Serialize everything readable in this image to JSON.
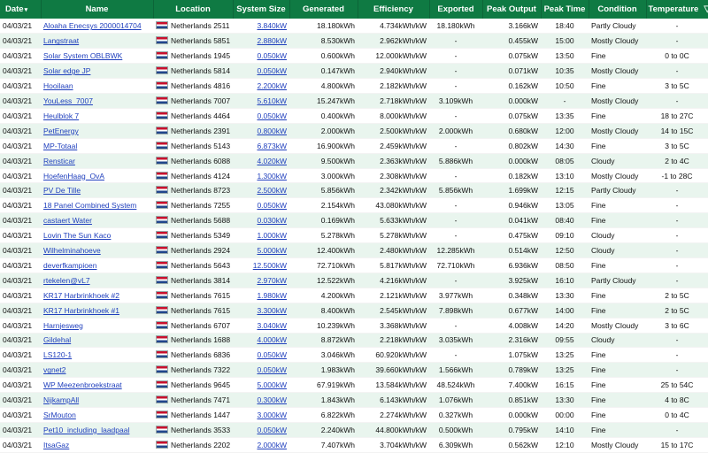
{
  "headers": {
    "date": "Date",
    "sort_indicator": "▾",
    "name": "Name",
    "location": "Location",
    "system_size": "System Size",
    "generated": "Generated",
    "efficiency": "Efficiency",
    "exported": "Exported",
    "peak_output": "Peak Output",
    "peak_time": "Peak Time",
    "condition": "Condition",
    "temperature": "Temperature",
    "filter_icon": "▽"
  },
  "rows": [
    {
      "date": "04/03/21",
      "name": "Aloaha Enecsys 2000014704",
      "location": "Netherlands 2511",
      "size": "3.840kW",
      "generated": "18.180kWh",
      "efficiency": "4.734kWh/kW",
      "exported": "18.180kWh",
      "peak": "3.166kW",
      "time": "18:40",
      "condition": "Partly Cloudy",
      "temp": "-"
    },
    {
      "date": "04/03/21",
      "name": "Langstraat",
      "location": "Netherlands 5851",
      "size": "2.880kW",
      "generated": "8.530kWh",
      "efficiency": "2.962kWh/kW",
      "exported": "-",
      "peak": "0.455kW",
      "time": "15:00",
      "condition": "Mostly Cloudy",
      "temp": "-"
    },
    {
      "date": "04/03/21",
      "name": "Solar System OBLBWK",
      "location": "Netherlands 1945",
      "size": "0.050kW",
      "generated": "0.600kWh",
      "efficiency": "12.000kWh/kW",
      "exported": "-",
      "peak": "0.075kW",
      "time": "13:50",
      "condition": "Fine",
      "temp": "0 to 0C"
    },
    {
      "date": "04/03/21",
      "name": "Solar edge JP",
      "location": "Netherlands 5814",
      "size": "0.050kW",
      "generated": "0.147kWh",
      "efficiency": "2.940kWh/kW",
      "exported": "-",
      "peak": "0.071kW",
      "time": "10:35",
      "condition": "Mostly Cloudy",
      "temp": "-"
    },
    {
      "date": "04/03/21",
      "name": "Hooilaan",
      "location": "Netherlands 4816",
      "size": "2.200kW",
      "generated": "4.800kWh",
      "efficiency": "2.182kWh/kW",
      "exported": "-",
      "peak": "0.162kW",
      "time": "10:50",
      "condition": "Fine",
      "temp": "3 to 5C"
    },
    {
      "date": "04/03/21",
      "name": "YouLess_7007",
      "location": "Netherlands 7007",
      "size": "5.610kW",
      "generated": "15.247kWh",
      "efficiency": "2.718kWh/kW",
      "exported": "3.109kWh",
      "peak": "0.000kW",
      "time": "-",
      "condition": "Mostly Cloudy",
      "temp": "-"
    },
    {
      "date": "04/03/21",
      "name": "Heulblok 7",
      "location": "Netherlands 4464",
      "size": "0.050kW",
      "generated": "0.400kWh",
      "efficiency": "8.000kWh/kW",
      "exported": "-",
      "peak": "0.075kW",
      "time": "13:35",
      "condition": "Fine",
      "temp": "18 to 27C"
    },
    {
      "date": "04/03/21",
      "name": "PetEnergy",
      "location": "Netherlands 2391",
      "size": "0.800kW",
      "generated": "2.000kWh",
      "efficiency": "2.500kWh/kW",
      "exported": "2.000kWh",
      "peak": "0.680kW",
      "time": "12:00",
      "condition": "Mostly Cloudy",
      "temp": "14 to 15C"
    },
    {
      "date": "04/03/21",
      "name": "MP-Totaal",
      "location": "Netherlands 5143",
      "size": "6.873kW",
      "generated": "16.900kWh",
      "efficiency": "2.459kWh/kW",
      "exported": "-",
      "peak": "0.802kW",
      "time": "14:30",
      "condition": "Fine",
      "temp": "3 to 5C"
    },
    {
      "date": "04/03/21",
      "name": "Rensticar",
      "location": "Netherlands 6088",
      "size": "4.020kW",
      "generated": "9.500kWh",
      "efficiency": "2.363kWh/kW",
      "exported": "5.886kWh",
      "peak": "0.000kW",
      "time": "08:05",
      "condition": "Cloudy",
      "temp": "2 to 4C"
    },
    {
      "date": "04/03/21",
      "name": "HoefenHaag_OvA",
      "location": "Netherlands 4124",
      "size": "1.300kW",
      "generated": "3.000kWh",
      "efficiency": "2.308kWh/kW",
      "exported": "-",
      "peak": "0.182kW",
      "time": "13:10",
      "condition": "Mostly Cloudy",
      "temp": "-1 to 28C"
    },
    {
      "date": "04/03/21",
      "name": "PV De Tille",
      "location": "Netherlands 8723",
      "size": "2.500kW",
      "generated": "5.856kWh",
      "efficiency": "2.342kWh/kW",
      "exported": "5.856kWh",
      "peak": "1.699kW",
      "time": "12:15",
      "condition": "Partly Cloudy",
      "temp": "-"
    },
    {
      "date": "04/03/21",
      "name": "18 Panel Combined System",
      "location": "Netherlands 7255",
      "size": "0.050kW",
      "generated": "2.154kWh",
      "efficiency": "43.080kWh/kW",
      "exported": "-",
      "peak": "0.946kW",
      "time": "13:05",
      "condition": "Fine",
      "temp": "-"
    },
    {
      "date": "04/03/21",
      "name": "castaert Water",
      "location": "Netherlands 5688",
      "size": "0.030kW",
      "generated": "0.169kWh",
      "efficiency": "5.633kWh/kW",
      "exported": "-",
      "peak": "0.041kW",
      "time": "08:40",
      "condition": "Fine",
      "temp": "-"
    },
    {
      "date": "04/03/21",
      "name": "Lovin The Sun Kaco",
      "location": "Netherlands 5349",
      "size": "1.000kW",
      "generated": "5.278kWh",
      "efficiency": "5.278kWh/kW",
      "exported": "-",
      "peak": "0.475kW",
      "time": "09:10",
      "condition": "Cloudy",
      "temp": "-"
    },
    {
      "date": "04/03/21",
      "name": "Wilhelminahoeve",
      "location": "Netherlands 2924",
      "size": "5.000kW",
      "generated": "12.400kWh",
      "efficiency": "2.480kWh/kW",
      "exported": "12.285kWh",
      "peak": "0.514kW",
      "time": "12:50",
      "condition": "Cloudy",
      "temp": "-"
    },
    {
      "date": "04/03/21",
      "name": "deverfkampioen",
      "location": "Netherlands 5643",
      "size": "12.500kW",
      "generated": "72.710kWh",
      "efficiency": "5.817kWh/kW",
      "exported": "72.710kWh",
      "peak": "6.936kW",
      "time": "08:50",
      "condition": "Fine",
      "temp": "-"
    },
    {
      "date": "04/03/21",
      "name": "rtekelen@vL7",
      "location": "Netherlands 3814",
      "size": "2.970kW",
      "generated": "12.522kWh",
      "efficiency": "4.216kWh/kW",
      "exported": "-",
      "peak": "3.925kW",
      "time": "16:10",
      "condition": "Partly Cloudy",
      "temp": "-"
    },
    {
      "date": "04/03/21",
      "name": "KR17 Harbrinkhoek #2",
      "location": "Netherlands 7615",
      "size": "1.980kW",
      "generated": "4.200kWh",
      "efficiency": "2.121kWh/kW",
      "exported": "3.977kWh",
      "peak": "0.348kW",
      "time": "13:30",
      "condition": "Fine",
      "temp": "2 to 5C"
    },
    {
      "date": "04/03/21",
      "name": "KR17 Harbrinkhoek #1",
      "location": "Netherlands 7615",
      "size": "3.300kW",
      "generated": "8.400kWh",
      "efficiency": "2.545kWh/kW",
      "exported": "7.898kWh",
      "peak": "0.677kW",
      "time": "14:00",
      "condition": "Fine",
      "temp": "2 to 5C"
    },
    {
      "date": "04/03/21",
      "name": "Harnjesweg",
      "location": "Netherlands 6707",
      "size": "3.040kW",
      "generated": "10.239kWh",
      "efficiency": "3.368kWh/kW",
      "exported": "-",
      "peak": "4.008kW",
      "time": "14:20",
      "condition": "Mostly Cloudy",
      "temp": "3 to 6C"
    },
    {
      "date": "04/03/21",
      "name": "Gildehal",
      "location": "Netherlands 1688",
      "size": "4.000kW",
      "generated": "8.872kWh",
      "efficiency": "2.218kWh/kW",
      "exported": "3.035kWh",
      "peak": "2.316kW",
      "time": "09:55",
      "condition": "Cloudy",
      "temp": "-"
    },
    {
      "date": "04/03/21",
      "name": "LS120-1",
      "location": "Netherlands 6836",
      "size": "0.050kW",
      "generated": "3.046kWh",
      "efficiency": "60.920kWh/kW",
      "exported": "-",
      "peak": "1.075kW",
      "time": "13:25",
      "condition": "Fine",
      "temp": "-"
    },
    {
      "date": "04/03/21",
      "name": "vgnet2",
      "location": "Netherlands 7322",
      "size": "0.050kW",
      "generated": "1.983kWh",
      "efficiency": "39.660kWh/kW",
      "exported": "1.566kWh",
      "peak": "0.789kW",
      "time": "13:25",
      "condition": "Fine",
      "temp": "-"
    },
    {
      "date": "04/03/21",
      "name": "WP Meezenbroekstraat",
      "location": "Netherlands 9645",
      "size": "5.000kW",
      "generated": "67.919kWh",
      "efficiency": "13.584kWh/kW",
      "exported": "48.524kWh",
      "peak": "7.400kW",
      "time": "16:15",
      "condition": "Fine",
      "temp": "25 to 54C"
    },
    {
      "date": "04/03/21",
      "name": "NijkampAll",
      "location": "Netherlands 7471",
      "size": "0.300kW",
      "generated": "1.843kWh",
      "efficiency": "6.143kWh/kW",
      "exported": "1.076kWh",
      "peak": "0.851kW",
      "time": "13:30",
      "condition": "Fine",
      "temp": "4 to 8C"
    },
    {
      "date": "04/03/21",
      "name": "SrMouton",
      "location": "Netherlands 1447",
      "size": "3.000kW",
      "generated": "6.822kWh",
      "efficiency": "2.274kWh/kW",
      "exported": "0.327kWh",
      "peak": "0.000kW",
      "time": "00:00",
      "condition": "Fine",
      "temp": "0 to 4C"
    },
    {
      "date": "04/03/21",
      "name": "Pet10_including_laadpaal",
      "location": "Netherlands 3533",
      "size": "0.050kW",
      "generated": "2.240kWh",
      "efficiency": "44.800kWh/kW",
      "exported": "0.500kWh",
      "peak": "0.795kW",
      "time": "14:10",
      "condition": "Fine",
      "temp": "-"
    },
    {
      "date": "04/03/21",
      "name": "ItsaGaz",
      "location": "Netherlands 2202",
      "size": "2.000kW",
      "generated": "7.407kWh",
      "efficiency": "3.704kWh/kW",
      "exported": "6.309kWh",
      "peak": "0.562kW",
      "time": "12:10",
      "condition": "Mostly Cloudy",
      "temp": "15 to 17C"
    }
  ]
}
